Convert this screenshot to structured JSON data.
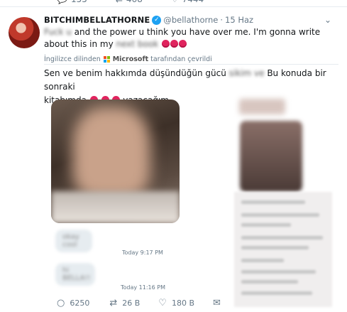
{
  "prev_tweet": {
    "replies": "155",
    "retweets": "468",
    "likes": "7444"
  },
  "tweet": {
    "display_name": "BITCHIMBELLATHORNE",
    "handle": "@bellathorne",
    "separator": "·",
    "date": "15 Haz",
    "text_hidden_start": "Fuck u",
    "text_visible": " and the power u think you have over me. I'm gonna write about this in my ",
    "text_hidden_end": "next book",
    "translation_source": "İngilizce dilinden",
    "translation_brand": "Microsoft",
    "translation_suffix": "tarafından çevrildi",
    "translated_part1": "Sen ve benim hakkımda düşündüğün gücü",
    "translated_hidden": "sikim ve",
    "translated_part2": "Bu konuda bir sonraki",
    "translated_part3": "kitabımda",
    "translated_part4": "yazacağım."
  },
  "media": {
    "bubble1_text": "okay cool",
    "bubble2_text": "hi BELLA!!",
    "time1": "Today 9:17 PM",
    "time2": "Today 11:16 PM"
  },
  "actions": {
    "replies": "6250",
    "retweets": "26 B",
    "likes": "180 B"
  },
  "icons": {
    "verified": "verified-badge-icon",
    "caret": "chevron-down-icon",
    "reply": "reply-icon",
    "retweet": "retweet-icon",
    "like": "heart-icon",
    "share": "share-icon"
  },
  "colors": {
    "accent": "#1da1f2",
    "muted": "#657786",
    "emoji": "#e0245e"
  }
}
